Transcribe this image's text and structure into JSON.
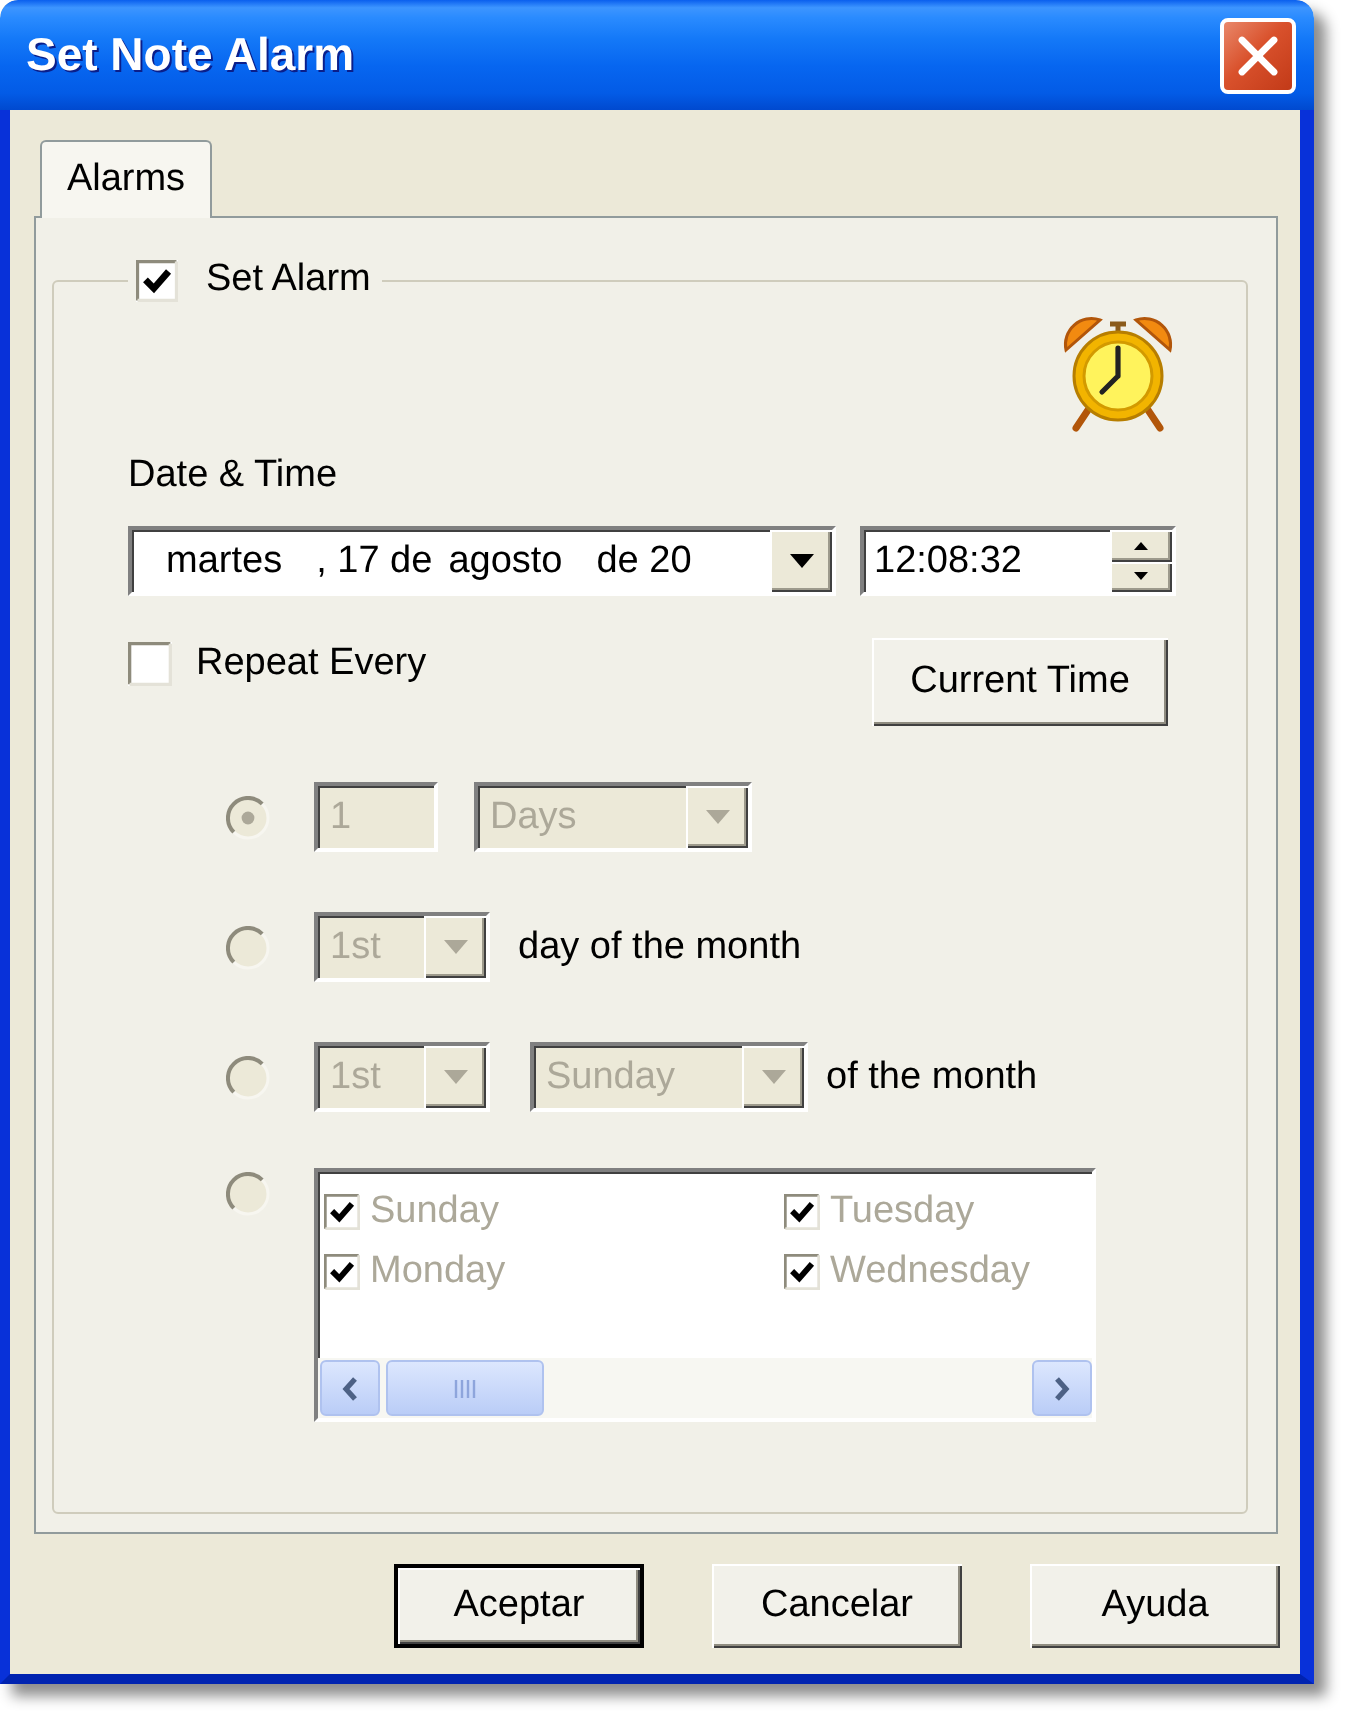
{
  "window": {
    "title": "Set Note Alarm"
  },
  "tabs": [
    {
      "label": "Alarms",
      "selected": true
    }
  ],
  "set_alarm": {
    "label": "Set Alarm",
    "checked": true
  },
  "date_time": {
    "label": "Date & Time",
    "date_parts": [
      "martes",
      ", 17 de",
      "agosto",
      "de 20"
    ],
    "time": "12:08:32"
  },
  "repeat": {
    "label": "Repeat Every",
    "checked": false
  },
  "current_time_button": "Current Time",
  "options": [
    {
      "kind": "interval",
      "selected": true,
      "disabled": true,
      "count": "1",
      "unit": "Days"
    },
    {
      "kind": "day_of_month",
      "selected": false,
      "disabled": true,
      "ordinal": "1st",
      "text": "day of the month"
    },
    {
      "kind": "weekday_of_month",
      "selected": false,
      "disabled": true,
      "ordinal": "1st",
      "weekday": "Sunday",
      "text": "of the month"
    },
    {
      "kind": "weekdays",
      "selected": false,
      "disabled": true,
      "days": [
        {
          "label": "Sunday",
          "checked": true
        },
        {
          "label": "Monday",
          "checked": true
        },
        {
          "label": "Tuesday",
          "checked": true
        },
        {
          "label": "Wednesday",
          "checked": true
        }
      ]
    }
  ],
  "buttons": [
    {
      "label": "Aceptar",
      "default": true
    },
    {
      "label": "Cancelar",
      "default": false
    },
    {
      "label": "Ayuda",
      "default": false
    }
  ]
}
